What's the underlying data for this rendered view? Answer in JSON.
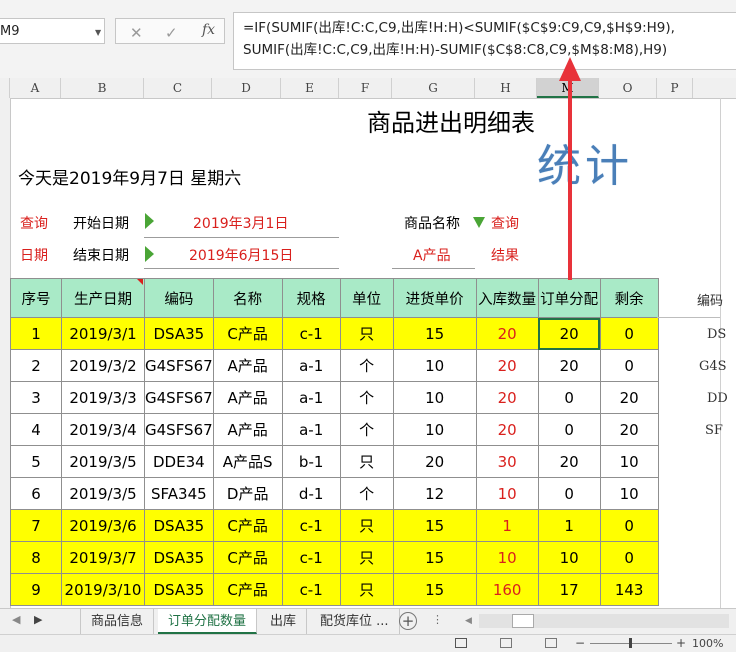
{
  "formula_bar": {
    "name_box": "M9",
    "cancel_glyph": "✕",
    "enter_glyph": "✓",
    "fx_label": "fx",
    "formula_line1": "=IF(SUMIF(出库!C:C,C9,出库!H:H)<SUMIF($C$9:C9,C9,$H$9:H9),",
    "formula_line2": "SUMIF(出库!C:C,C9,出库!H:H)-SUMIF($C$8:C8,C9,$M$8:M8),H9)"
  },
  "columns": [
    "A",
    "B",
    "C",
    "D",
    "E",
    "F",
    "G",
    "H",
    "M",
    "O",
    "P"
  ],
  "selected_column": "M",
  "sheet": {
    "title": "商品进出明细表",
    "overlay_text": "统计",
    "today_label": "今天是2019年9月7日   星期六",
    "query_label": "查询",
    "start_date_label": "开始日期",
    "start_date_value": "2019年3月1日",
    "date_label": "日期",
    "end_date_label": "结束日期",
    "end_date_value": "2019年6月15日",
    "product_name_label": "商品名称",
    "query_label2": "查询",
    "product_value": "A产品",
    "result_label": "结果"
  },
  "table": {
    "headers": [
      "序号",
      "生产日期",
      "编码",
      "名称",
      "规格",
      "单位",
      "进货单价",
      "入库数量",
      "订单分配",
      "剩余"
    ],
    "rows": [
      [
        "1",
        "2019/3/1",
        "DSA35",
        "C产品",
        "c-1",
        "只",
        "15",
        "20",
        "20",
        "0"
      ],
      [
        "2",
        "2019/3/2",
        "G4SFS67",
        "A产品",
        "a-1",
        "个",
        "10",
        "20",
        "20",
        "0"
      ],
      [
        "3",
        "2019/3/3",
        "G4SFS67",
        "A产品",
        "a-1",
        "个",
        "10",
        "20",
        "0",
        "20"
      ],
      [
        "4",
        "2019/3/4",
        "G4SFS67",
        "A产品",
        "a-1",
        "个",
        "10",
        "20",
        "0",
        "20"
      ],
      [
        "5",
        "2019/3/5",
        "DDE34",
        "A产品S",
        "b-1",
        "只",
        "20",
        "30",
        "20",
        "10"
      ],
      [
        "6",
        "2019/3/5",
        "SFA345",
        "D产品",
        "d-1",
        "个",
        "12",
        "10",
        "0",
        "10"
      ],
      [
        "7",
        "2019/3/6",
        "DSA35",
        "C产品",
        "c-1",
        "只",
        "15",
        "1",
        "1",
        "0"
      ],
      [
        "8",
        "2019/3/7",
        "DSA35",
        "C产品",
        "c-1",
        "只",
        "15",
        "10",
        "10",
        "0"
      ],
      [
        "9",
        "2019/3/10",
        "DSA35",
        "C产品",
        "c-1",
        "只",
        "15",
        "160",
        "17",
        "143"
      ]
    ],
    "highlighted_rows": [
      0,
      6,
      7,
      8
    ]
  },
  "right_column": {
    "header": "编码",
    "values": [
      "DS",
      "G4S",
      "DD",
      "SF"
    ]
  },
  "tabs": [
    "商品信息",
    "订单分配数量",
    "出库",
    "配货库位 ..."
  ],
  "active_tab": 1,
  "status": {
    "zoom": "100%"
  },
  "colors": {
    "header_fill": "#a9eac7",
    "highlight_fill": "#ffff00",
    "red_text": "#d9201d",
    "arrow": "#e8323a",
    "accent": "#217346"
  }
}
